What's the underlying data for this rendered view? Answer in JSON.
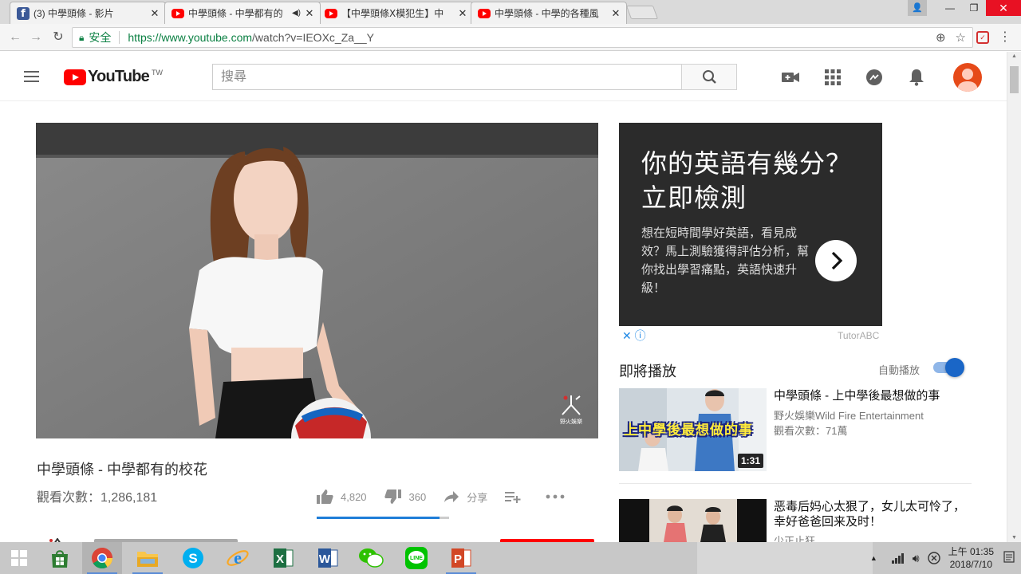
{
  "browser": {
    "tabs": [
      {
        "label": "(3) 中學頭條 - 影片",
        "icon": "facebook-icon"
      },
      {
        "label": "中學頭條 - 中學都有的",
        "icon": "youtube-icon",
        "active": true,
        "audio": true
      },
      {
        "label": "【中學頭條Ⅹ模犯生】中",
        "icon": "youtube-icon"
      },
      {
        "label": "中學頭條 - 中學的各種風",
        "icon": "youtube-icon"
      }
    ],
    "secure_label": "安全",
    "url_main": "https://www.youtube.com",
    "url_rest": "/watch?v=IEOXc_Za__Y"
  },
  "youtube": {
    "logo_text": "YouTube",
    "region": "TW",
    "search_placeholder": "搜尋"
  },
  "video": {
    "title": "中學頭條 - 中學都有的校花",
    "views": "觀看次數：1,286,181",
    "likes": "4,820",
    "dislikes": "360",
    "share": "分享",
    "watermark": "野火娛樂",
    "like_ratio": 0.93
  },
  "ad": {
    "headline_1": "你的英語有幾分？",
    "headline_2": "立即檢測",
    "body": "想在短時間學好英語，看見成效？馬上測驗獲得評估分析，幫你找出學習痛點，英語快速升級！",
    "sponsor": "TutorABC"
  },
  "sidebar": {
    "up_next": "即將播放",
    "autoplay": "自動播放",
    "autoplay_on": true,
    "recs": [
      {
        "title": "中學頭條 - 上中學後最想做的事",
        "channel": "野火娛樂Wild Fire Entertainment",
        "views": "觀看次數：71萬",
        "duration": "1:31",
        "thumb_caption": "上中學後最想做的事"
      },
      {
        "title": "恶毒后妈心太狠了，女儿太可怜了，幸好爸爸回来及时！",
        "channel": "少正止狂"
      }
    ]
  },
  "taskbar": {
    "clock_time": "上午 01:35",
    "clock_date": "2018/7/10"
  },
  "colors": {
    "youtube_red": "#ff0000",
    "chrome_green": "#0b8043",
    "link_blue": "#1e88e5",
    "ad_bg": "#2b2b2b"
  }
}
